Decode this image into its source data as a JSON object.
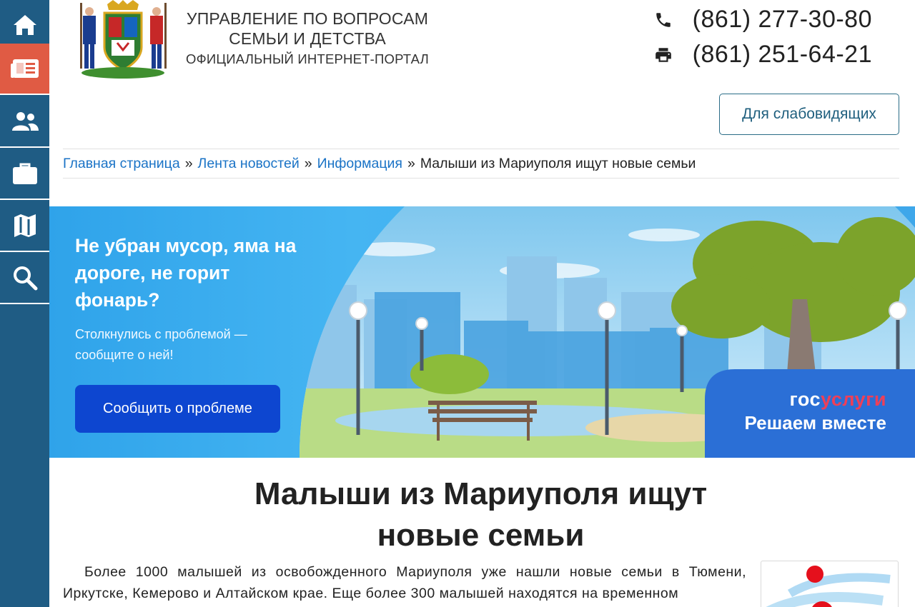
{
  "sidebar": {
    "items": [
      {
        "name": "home",
        "icon": "home-icon"
      },
      {
        "name": "news",
        "icon": "newspaper-icon",
        "active": true
      },
      {
        "name": "people",
        "icon": "people-icon"
      },
      {
        "name": "services",
        "icon": "briefcase-icon"
      },
      {
        "name": "map",
        "icon": "map-icon"
      },
      {
        "name": "search",
        "icon": "search-icon"
      }
    ],
    "colors": {
      "background": "#1f5c84",
      "active": "#e05b44"
    }
  },
  "header": {
    "org_line1": "УПРАВЛЕНИЕ ПО ВОПРОСАМ",
    "org_line2": "СЕМЬИ И ДЕТСТВА",
    "org_line3": "ОФИЦИАЛЬНЫЙ ИНТЕРНЕТ-ПОРТАЛ",
    "phone": "(861) 277-30-80",
    "fax": "(861) 251-64-21",
    "accessibility_button": "Для слабовидящих"
  },
  "breadcrumb": {
    "items": [
      "Главная страница",
      "Лента новостей",
      "Информация"
    ],
    "separator": "»",
    "current": "Малыши из Мариуполя ищут новые семьи"
  },
  "banner": {
    "title": "Не убран мусор, яма на дороге, не горит фонарь?",
    "subtitle": "Столкнулись с проблемой — сообщите о ней!",
    "button": "Сообщить о проблеме",
    "brand_part1": "гос",
    "brand_part2": "услуги",
    "slogan": "Решаем вместе",
    "colors": {
      "button": "#0d46d0",
      "brand_accent": "#ee3f58",
      "badge": "#2b6fd6"
    }
  },
  "article": {
    "title_line1": "Малыши из Мариуполя ищут",
    "title_line2": "новые семьи",
    "body": "Более 1000 малышей из освобожденного Мариуполя уже нашли новые семьи в Тюмени, Иркутске, Кемерово и Алтайском крае. Еще более 300 малышей находятся на временном"
  }
}
